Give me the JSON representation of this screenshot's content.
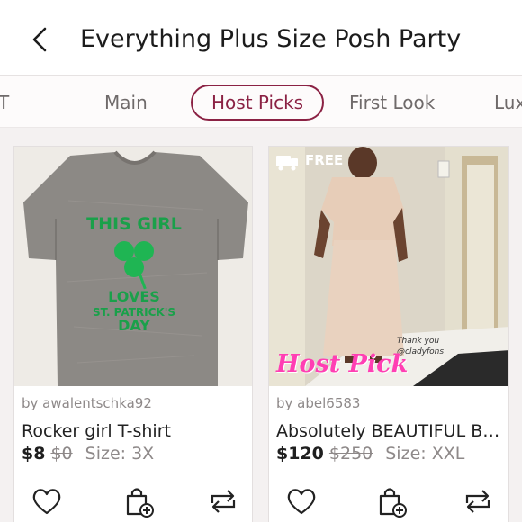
{
  "header": {
    "title": "Everything Plus Size Posh Party",
    "back_icon": "chevron-left-icon"
  },
  "tabs": [
    {
      "label": "T",
      "active": false
    },
    {
      "label": "Main",
      "active": false
    },
    {
      "label": "Host Picks",
      "active": true
    },
    {
      "label": "First Look",
      "active": false
    },
    {
      "label": "Lux",
      "active": false
    }
  ],
  "accent_color": "#8b2244",
  "listings": [
    {
      "seller": "by awalentschka92",
      "title": "Rocker girl T-shirt",
      "price": "$8",
      "original_price": "$0",
      "size": "Size: 3X",
      "shirt_text": [
        "THIS GIRL",
        "LOVES",
        "ST. PATRICK'S",
        "DAY"
      ]
    },
    {
      "seller": "by abel6583",
      "title": "Absolutely BEAUTIFUL Be...",
      "price": "$120",
      "original_price": "$250",
      "size": "Size: XXL",
      "badge": "FREE",
      "overlay_text": "Host Pick",
      "photo_caption": [
        "Thank you",
        "@cladyfons"
      ]
    }
  ],
  "action_icons": [
    "heart-icon",
    "shopping-bag-add-icon",
    "share-icon"
  ]
}
